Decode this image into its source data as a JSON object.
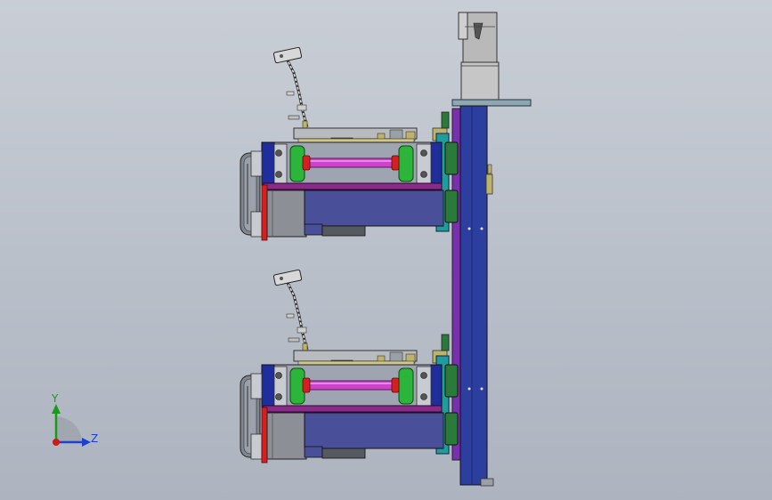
{
  "triad": {
    "y_label": "Y",
    "z_label": "Z",
    "y_color": "#1a9a1a",
    "z_color": "#1e3fd0",
    "x_color": "#d01818"
  },
  "colors": {
    "column": "#2d3f9e",
    "column_purple": "#7a2fb3",
    "frame_blue": "#1f2e9c",
    "rail": "#8a2a8a",
    "shaft": "#cc44cc",
    "wheel_green": "#2bb53a",
    "hub_red": "#d42020",
    "motor": "#4a4f9a",
    "plate_teal": "#1f9c9c",
    "bracket_green": "#2a7a3a",
    "tan": "#bfb36b",
    "gray_part": "#9aa0a8"
  },
  "units": [
    "upper-unit",
    "lower-unit"
  ]
}
